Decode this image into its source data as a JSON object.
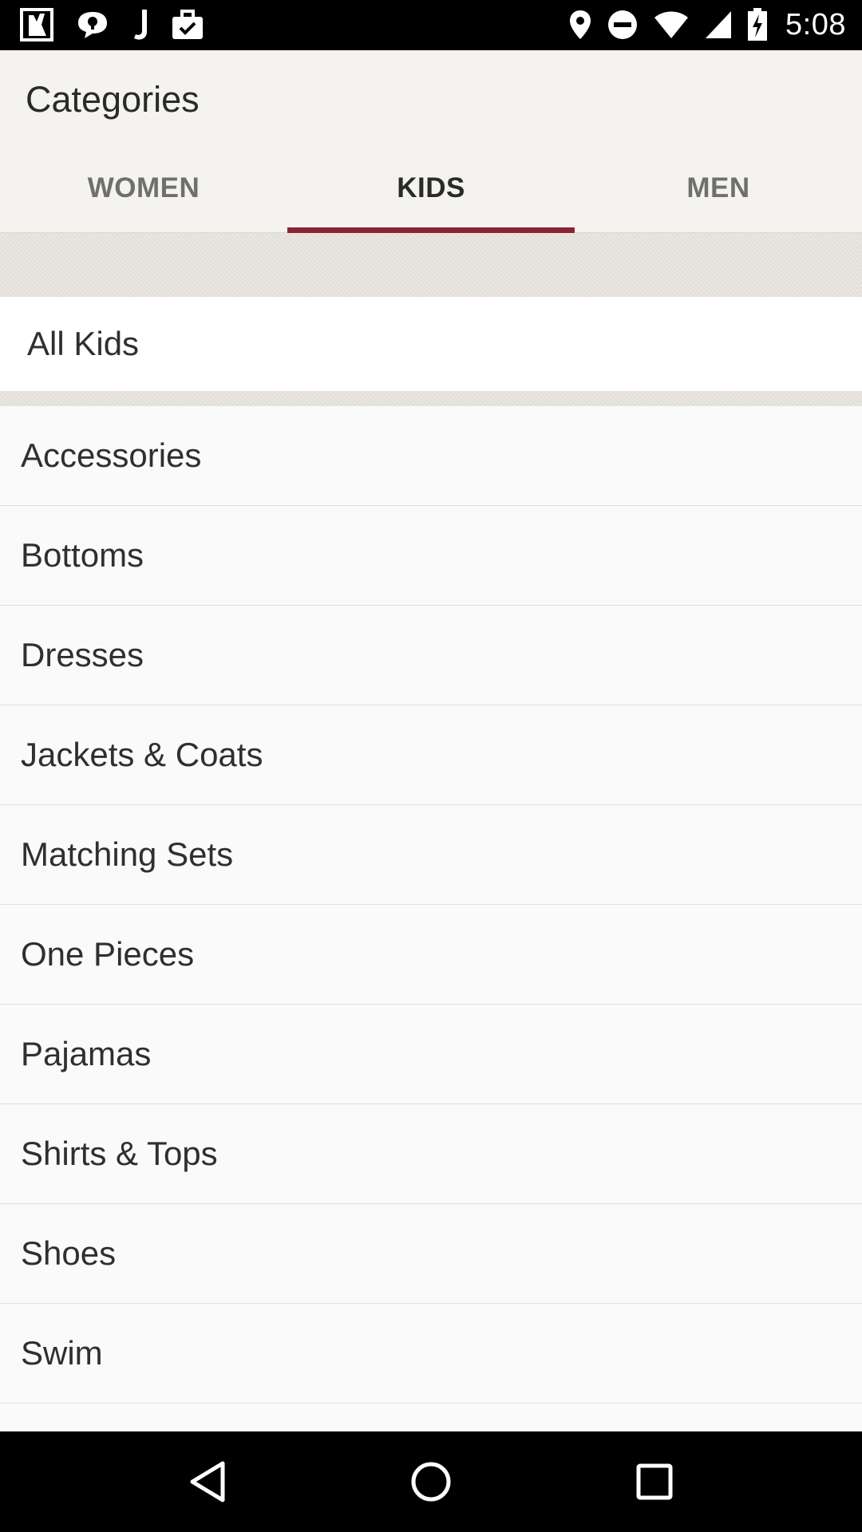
{
  "status_bar": {
    "time": "5:08",
    "left_icons": [
      "app-notification-icon",
      "chat-bubble-icon",
      "music-note-icon",
      "briefcase-check-icon"
    ],
    "right_icons": [
      "location-pin-icon",
      "do-not-disturb-icon",
      "wifi-icon",
      "cell-signal-icon",
      "battery-charging-icon"
    ]
  },
  "app_bar": {
    "title": "Categories",
    "tabs": [
      {
        "label": "WOMEN",
        "active": false
      },
      {
        "label": "KIDS",
        "active": true
      },
      {
        "label": "MEN",
        "active": false
      }
    ],
    "accent_color": "#8b2432"
  },
  "all_row": {
    "label": "All Kids"
  },
  "categories": [
    {
      "label": "Accessories"
    },
    {
      "label": "Bottoms"
    },
    {
      "label": "Dresses"
    },
    {
      "label": "Jackets & Coats"
    },
    {
      "label": "Matching Sets"
    },
    {
      "label": "One Pieces"
    },
    {
      "label": "Pajamas"
    },
    {
      "label": "Shirts & Tops"
    },
    {
      "label": "Shoes"
    },
    {
      "label": "Swim"
    }
  ],
  "nav_bar": {
    "buttons": [
      "back-icon",
      "home-icon",
      "recents-icon"
    ]
  }
}
